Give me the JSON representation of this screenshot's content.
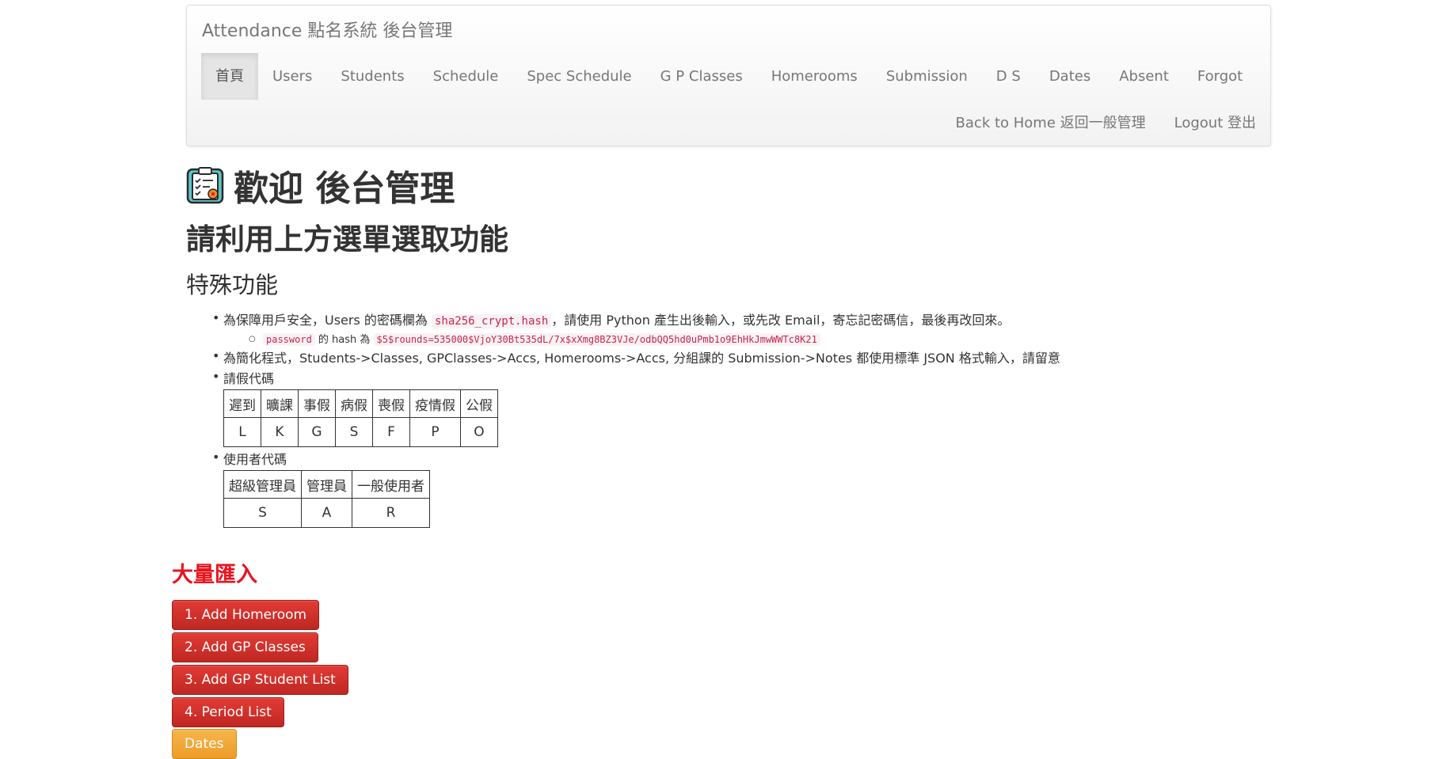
{
  "navbar": {
    "brand": "Attendance 點名系統 後台管理",
    "items": [
      {
        "label": "首頁",
        "active": true
      },
      {
        "label": "Users"
      },
      {
        "label": "Students"
      },
      {
        "label": "Schedule"
      },
      {
        "label": "Spec Schedule"
      },
      {
        "label": "G P Classes"
      },
      {
        "label": "Homerooms"
      },
      {
        "label": "Submission"
      },
      {
        "label": "D S"
      },
      {
        "label": "Dates"
      },
      {
        "label": "Absent"
      },
      {
        "label": "Forgot"
      }
    ],
    "right_items": [
      {
        "label": "Back to Home 返回一般管理"
      },
      {
        "label": "Logout 登出"
      }
    ]
  },
  "main": {
    "title": "歡迎 後台管理",
    "subtitle": "請利用上方選單選取功能",
    "special_heading": "特殊功能",
    "bullet1": {
      "text_before": "為保障用戶安全，Users 的密碼欄為 ",
      "code": "sha256_crypt.hash",
      "text_after": "，請使用 Python 產生出後輸入，或先改 Email，寄忘記密碼信，最後再改回來。",
      "sub_code1": "password",
      "sub_text": " 的 hash 為 ",
      "sub_code2": "$5$rounds=535000$VjoY30Bt535dL/7x$xXmg8BZ3VJe/odbQQ5hd0uPmb1o9EhHkJmwWWTc8K21"
    },
    "bullet2": "為簡化程式，Students->Classes, GPClasses->Accs, Homerooms->Accs, 分組課的 Submission->Notes 都使用標準 JSON 格式輸入，請留意",
    "leave_codes": {
      "label": "請假代碼",
      "headers": [
        "遲到",
        "曠課",
        "事假",
        "病假",
        "喪假",
        "疫情假",
        "公假"
      ],
      "values": [
        "L",
        "K",
        "G",
        "S",
        "F",
        "P",
        "O"
      ]
    },
    "user_codes": {
      "label": "使用者代碼",
      "headers": [
        "超級管理員",
        "管理員",
        "一般使用者"
      ],
      "values": [
        "S",
        "A",
        "R"
      ]
    }
  },
  "import": {
    "title": "大量匯入",
    "buttons": [
      {
        "label": "1. Add Homeroom",
        "style": "danger"
      },
      {
        "label": "2. Add GP Classes",
        "style": "danger"
      },
      {
        "label": "3. Add GP Student List",
        "style": "danger"
      },
      {
        "label": "4. Period List",
        "style": "danger"
      },
      {
        "label": "Dates",
        "style": "warning"
      }
    ]
  },
  "colors": {
    "danger": "#d9302b",
    "warning": "#f0a030",
    "import_title": "#e8141e",
    "code_text": "#c7254e",
    "code_bg": "#f9f2f4"
  }
}
